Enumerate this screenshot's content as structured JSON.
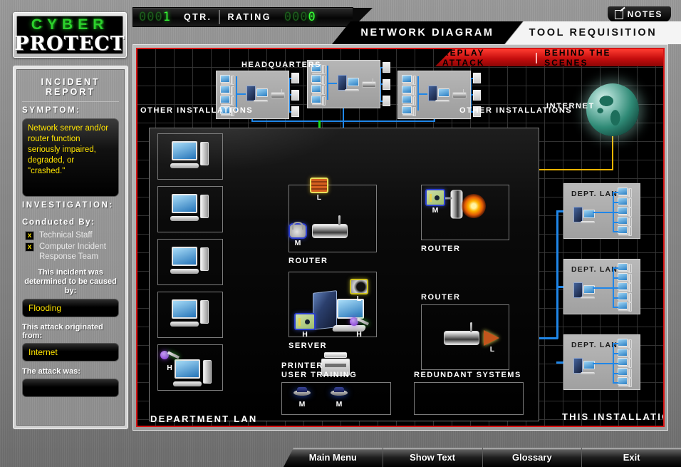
{
  "app": {
    "logo_line1": "CYBER",
    "logo_line2": "PROTECT"
  },
  "status_bar": {
    "qtr_value_dim": "000",
    "qtr_value": "1",
    "qtr_label": "QTR.",
    "rating_label": "RATING",
    "rating_value_dim": "000",
    "rating_value": "0"
  },
  "notes_button": {
    "label": "NOTES",
    "icon": "notes-icon"
  },
  "tabs": [
    {
      "label": "NETWORK DIAGRAM",
      "active": true
    },
    {
      "label": "TOOL REQUISITION",
      "active": false
    }
  ],
  "red_tabs": [
    {
      "label": "REPLAY ATTACK"
    },
    {
      "label": "BEHIND THE SCENES"
    }
  ],
  "sidebar": {
    "title": "INCIDENT REPORT",
    "symptom_heading": "SYMPTOM:",
    "symptom_text": "Network server and/or router function seriously impaired, degraded, or \"crashed.\"",
    "investigation_heading": "INVESTIGATION:",
    "conducted_by_label": "Conducted By:",
    "conducted_by": [
      {
        "checked": "x",
        "label": "Technical Staff"
      },
      {
        "checked": "x",
        "label": "Computer Incident Response Team"
      }
    ],
    "cause_label": "This incident was determined to be caused by:",
    "cause_value": "Flooding",
    "origin_label": "This attack originated from:",
    "origin_value": "Internet",
    "attack_label": "The attack was:",
    "attack_value": ""
  },
  "diagram": {
    "labels": {
      "headquarters": "HEADQUARTERS",
      "other_installations_left": "OTHER INSTALLATIONS",
      "other_installations_right": "OTHER INSTALLATIONS",
      "internet": "INTERNET",
      "department_lan": "DEPARTMENT LAN",
      "this_installation": "THIS INSTALLATION",
      "printer": "PRINTER",
      "user_training": "USER TRAINING",
      "redundant_systems": "REDUNDANT SYSTEMS",
      "router_1": "ROUTER",
      "router_2": "ROUTER",
      "router_3": "ROUTER",
      "server": "SERVER",
      "dept_lan": "DEPT. LAN"
    },
    "defenses": [
      {
        "node": "router-1-top",
        "icon": "firewall-icon",
        "level": "L"
      },
      {
        "node": "router-1-side",
        "icon": "lock-icon",
        "level": "M"
      },
      {
        "node": "server-camera",
        "icon": "camera-icon",
        "level": "L"
      },
      {
        "node": "server-card",
        "icon": "id-card-icon",
        "level": "H"
      },
      {
        "node": "server-key",
        "icon": "key-icon",
        "level": "H"
      },
      {
        "node": "router-2",
        "icon": "id-badge-icon",
        "level": "M"
      },
      {
        "node": "router-3",
        "icon": "firewall-icon",
        "level": "L"
      },
      {
        "node": "workstation-5",
        "icon": "key-icon",
        "level": "H"
      },
      {
        "node": "user-training-1",
        "icon": "training-icon",
        "level": "M"
      },
      {
        "node": "user-training-2",
        "icon": "training-icon",
        "level": "M"
      }
    ],
    "workstation_count": 5,
    "dept_lan_count": 3,
    "dept_lan_pc_count": 5,
    "hq_pc_count": 4,
    "colors": {
      "wire_green": "#17e017",
      "wire_blue": "#1f86e8",
      "wire_yellow": "#f0b400",
      "alert_red": "#d81414",
      "lcd_green": "#35ff35",
      "field_text_yellow": "#ffe400"
    }
  },
  "bottom_buttons": [
    {
      "label": "Main Menu"
    },
    {
      "label": "Show Text"
    },
    {
      "label": "Glossary"
    },
    {
      "label": "Exit"
    }
  ]
}
